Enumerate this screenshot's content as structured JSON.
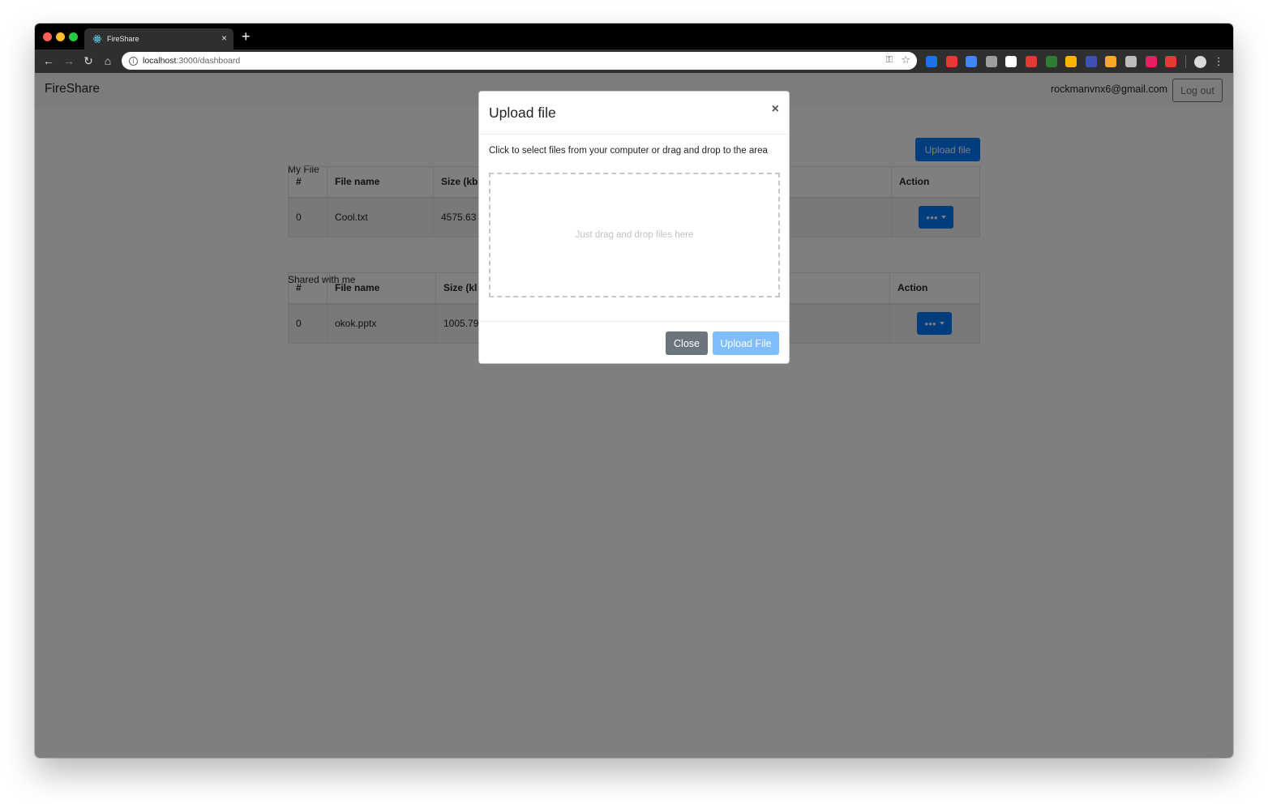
{
  "browser": {
    "tab_title": "FireShare",
    "tab_close": "×",
    "new_tab": "+",
    "url_host": "localhost",
    "url_path": ":3000/dashboard",
    "colors": {
      "ext": [
        "#1a73e8",
        "#e53935",
        "#4285f4",
        "#9e9e9e",
        "#ffffff",
        "#e53935",
        "#2e7d32",
        "#ffb300",
        "#3f51b5",
        "#f9a825",
        "#bdbdbd",
        "#e91e63",
        "#e53935"
      ]
    }
  },
  "app": {
    "brand": "FireShare",
    "user_email": "rockmanvnx6@gmail.com",
    "logout_label": "Log out",
    "upload_button_label": "Upload file"
  },
  "my_files": {
    "title": "My File",
    "columns": [
      "#",
      "File name",
      "Size (kb",
      "Action"
    ],
    "rows": [
      {
        "index": "0",
        "name": "Cool.txt",
        "size": "4575.63"
      }
    ]
  },
  "shared": {
    "title": "Shared with me",
    "columns": [
      "#",
      "File name",
      "Size (kl",
      "Action"
    ],
    "rows": [
      {
        "index": "0",
        "name": "okok.pptx",
        "size": "1005.79"
      }
    ]
  },
  "modal": {
    "title": "Upload file",
    "close_x": "×",
    "instruction": "Click to select files from your computer or drag and drop to the area",
    "dropzone_text": "Just drag and drop files here",
    "close_label": "Close",
    "upload_label": "Upload File"
  }
}
